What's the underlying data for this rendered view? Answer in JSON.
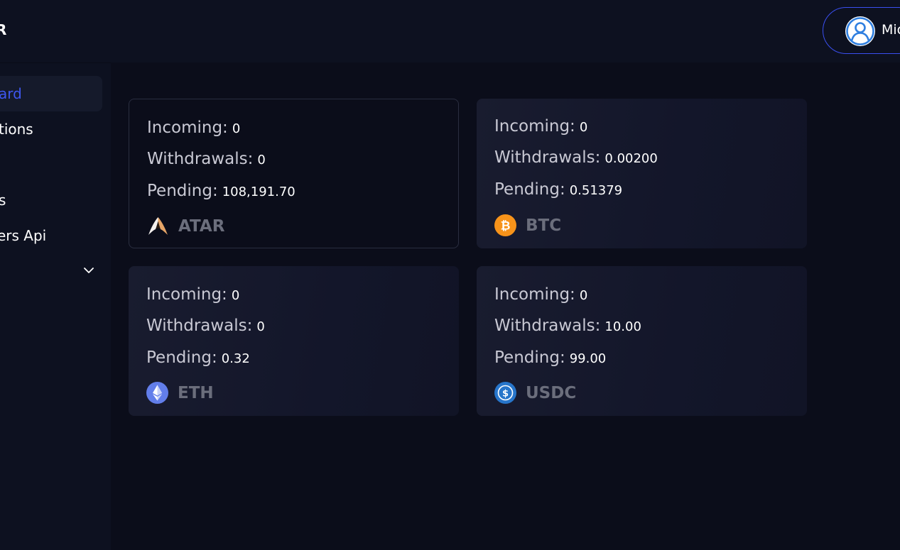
{
  "app": {
    "logo_text": "R"
  },
  "sidebar": {
    "items": [
      {
        "label": "ard",
        "active": true
      },
      {
        "label": "tions",
        "active": false
      },
      {
        "label": "s",
        "active": false
      },
      {
        "label": "ers Api",
        "active": false
      }
    ],
    "expand_icon": "chevron-down-icon"
  },
  "header": {
    "user_name": "Mic",
    "avatar_icon": "user-avatar-icon"
  },
  "labels": {
    "incoming": "Incoming:",
    "withdrawals": "Withdrawals:",
    "pending": "Pending:"
  },
  "cards": [
    {
      "coin": "ATAR",
      "icon": "atar-logo-icon",
      "incoming": "0",
      "withdrawals": "0",
      "pending": "108,191.70"
    },
    {
      "coin": "BTC",
      "icon": "bitcoin-icon",
      "incoming": "0",
      "withdrawals": "0.00200",
      "pending": "0.51379"
    },
    {
      "coin": "ETH",
      "icon": "ethereum-icon",
      "incoming": "0",
      "withdrawals": "0",
      "pending": "0.32"
    },
    {
      "coin": "USDC",
      "icon": "usdc-icon",
      "incoming": "0",
      "withdrawals": "10.00",
      "pending": "99.00"
    }
  ],
  "colors": {
    "background": "#0b0d1a",
    "panel": "#0d1120",
    "accent": "#3e57f0",
    "btc": "#f7931a",
    "eth": "#627eea",
    "usdc": "#2775ca"
  }
}
